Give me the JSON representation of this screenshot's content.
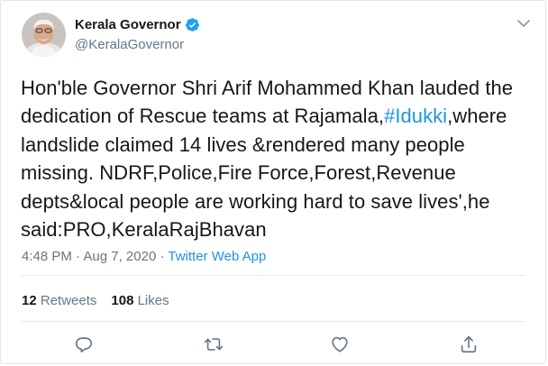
{
  "user": {
    "display_name": "Kerala Governor",
    "handle": "@KeralaGovernor",
    "verified": true
  },
  "tweet": {
    "lines": [
      [
        "Hon'ble Governor Shri Arif Mohammed Khan lauded the"
      ],
      [
        "dedication of Rescue teams at Rajamala,",
        "#Idukki",
        ",where"
      ],
      [
        "landslide claimed 14 lives &rendered many people"
      ],
      [
        "missing. NDRF,Police,Fire Force,Forest,Revenue"
      ],
      [
        "depts&local people are working hard to save lives',he"
      ],
      [
        "said:PRO,KeralaRajBhavan"
      ]
    ],
    "hashtag": "#Idukki"
  },
  "meta": {
    "time": "4:48 PM",
    "separator": "·",
    "date": "Aug 7, 2020",
    "source": "Twitter Web App"
  },
  "stats": {
    "retweets_count": "12",
    "retweets_label": "Retweets",
    "likes_count": "108",
    "likes_label": "Likes"
  },
  "icons": {
    "verified": "verified-badge-icon",
    "menu": "chevron-down-icon",
    "reply": "reply-icon",
    "retweet": "retweet-icon",
    "like": "heart-icon",
    "share": "share-icon"
  },
  "colors": {
    "link": "#1b95e0",
    "muted": "#657786",
    "text": "#14171a",
    "verified": "#1da1f2",
    "action_icon": "#657786"
  }
}
